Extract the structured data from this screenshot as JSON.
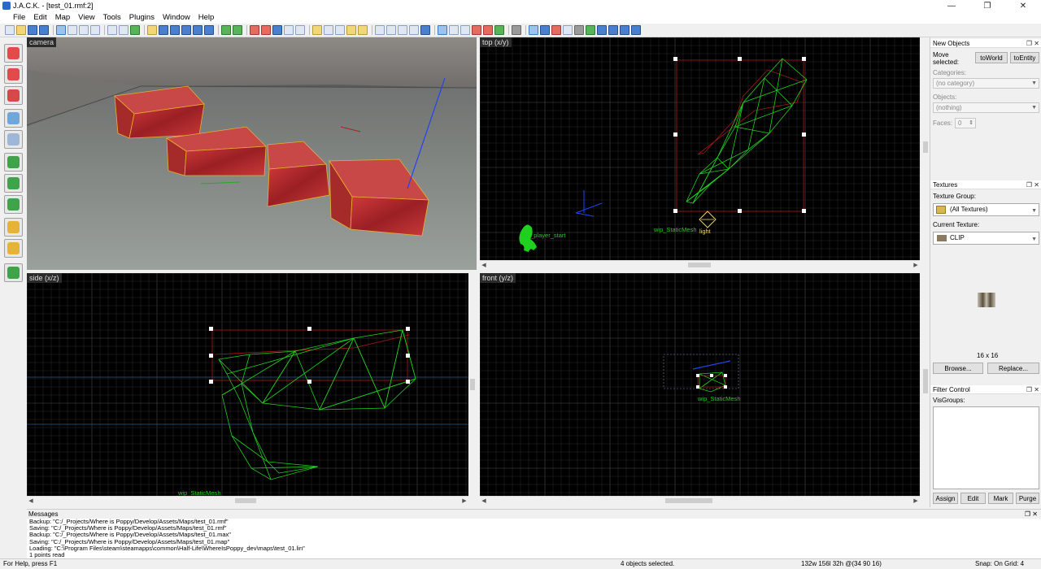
{
  "window": {
    "title": "J.A.C.K. - [test_01.rmf:2]",
    "controls": [
      "—",
      "❐",
      "✕"
    ]
  },
  "menu": [
    "File",
    "Edit",
    "Map",
    "View",
    "Tools",
    "Plugins",
    "Window",
    "Help"
  ],
  "viewports": {
    "camera": "camera",
    "top": "top (x/y)",
    "side": "side (x/z)",
    "front": "front (y/z)"
  },
  "entity_labels": {
    "player_start": "info_player_start",
    "light": "light",
    "top_mesh": "wip_StaticMesh",
    "side_mesh": "wip_StaticMesh",
    "front_mesh": "wip_StaticMesh"
  },
  "panels": {
    "new_objects": {
      "header": "New Objects",
      "move_selected_label": "Move selected:",
      "to_world": "toWorld",
      "to_entity": "toEntity",
      "categories_label": "Categories:",
      "categories_value": "(no category)",
      "objects_label": "Objects:",
      "objects_value": "(nothing)",
      "faces_label": "Faces:",
      "faces_value": "0"
    },
    "textures": {
      "header": "Textures",
      "group_label": "Texture Group:",
      "group_value": "(All Textures)",
      "current_label": "Current Texture:",
      "current_value": "CLIP",
      "size": "16 x 16",
      "browse": "Browse...",
      "replace": "Replace..."
    },
    "filter": {
      "header": "Filter Control",
      "visgroups_label": "VisGroups:",
      "assign": "Assign",
      "edit": "Edit",
      "mark": "Mark",
      "purge": "Purge"
    }
  },
  "messages": {
    "header": "Messages",
    "lines": [
      "Backup:  \"C:/_Projects/Where is Poppy/Develop/Assets/Maps/test_01.rmf\"",
      "Saving:  \"C:/_Projects/Where is Poppy/Develop/Assets/Maps/test_01.rmf\"",
      "Backup:  \"C:/_Projects/Where is Poppy/Develop/Assets/Maps/test_01.max\"",
      "Saving:  \"C:/_Projects/Where is Poppy/Develop/Assets/Maps/test_01.map\"",
      "Loading:  \"C:\\Program Files\\steam\\steamapps\\common\\Half-Life\\WhereIsPoppy_dev\\maps\\test_01.lin\"",
      "1 points read"
    ]
  },
  "status": {
    "help": "For Help, press F1",
    "selection": "4 objects selected.",
    "coords": "132w 156l 32h @(34 90 16)",
    "snap": "Snap: On Grid: 4"
  }
}
